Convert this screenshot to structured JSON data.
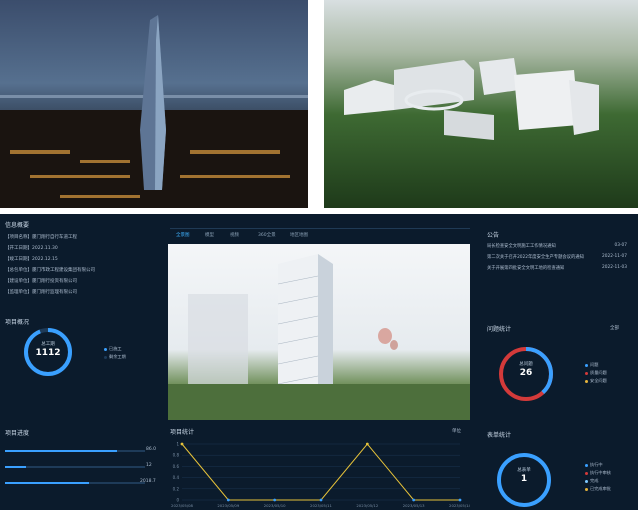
{
  "info": {
    "title": "信息概要",
    "rows": [
      "【项目名称】厦门翔行自行车道工程",
      "【开工日期】2022.11.30",
      "【竣工日期】2022.12.15",
      "【总包单位】厦门市政工程建设集团有限公司",
      "【建设单位】厦门翔行投资有限公司",
      "【监理单位】厦门翔行监理有限公司"
    ]
  },
  "overview": {
    "title": "项目概况",
    "ring_label": "总工期",
    "ring_value": "1112",
    "legend": [
      "已施工",
      "剩余工期"
    ]
  },
  "progress": {
    "title": "项目进度",
    "values": [
      "86.0",
      "12",
      "2018.7"
    ]
  },
  "tabs": [
    "全景图",
    "模型",
    "视频",
    "360全景",
    "地区地图"
  ],
  "notices": {
    "title": "公告",
    "items": [
      {
        "text": "局长检查安全文明施工工作情况通知",
        "date": "03-07"
      },
      {
        "text": "第二次关于召开2022年度安全生产专题会议的通知",
        "date": "2022-11-07"
      },
      {
        "text": "关于开展第四批安全文明工地的检查通知",
        "date": "2022-11-03"
      }
    ]
  },
  "issues": {
    "title": "问题统计",
    "filter": "全部",
    "ring_label": "总问题",
    "ring_value": "26",
    "legend": [
      "问题",
      "质量问题",
      "安全问题"
    ]
  },
  "reports": {
    "title": "表单统计",
    "ring_label": "总表单",
    "ring_value": "1",
    "legend": [
      "执行中",
      "执行中审核",
      "完成",
      "已完成审批"
    ]
  },
  "chart_data": {
    "type": "line",
    "title": "项目统计",
    "unit": "单位",
    "x": [
      "2023/05/08",
      "2023/05/09",
      "2023/05/10",
      "2023/05/11",
      "2023/05/12",
      "2023/05/13",
      "2023/05/14"
    ],
    "y_ticks": [
      "0",
      "0.2",
      "0.4",
      "0.6",
      "0.8",
      "1"
    ],
    "values": [
      1,
      0,
      0,
      0,
      1,
      0,
      0
    ],
    "ylim": [
      0,
      1
    ]
  }
}
